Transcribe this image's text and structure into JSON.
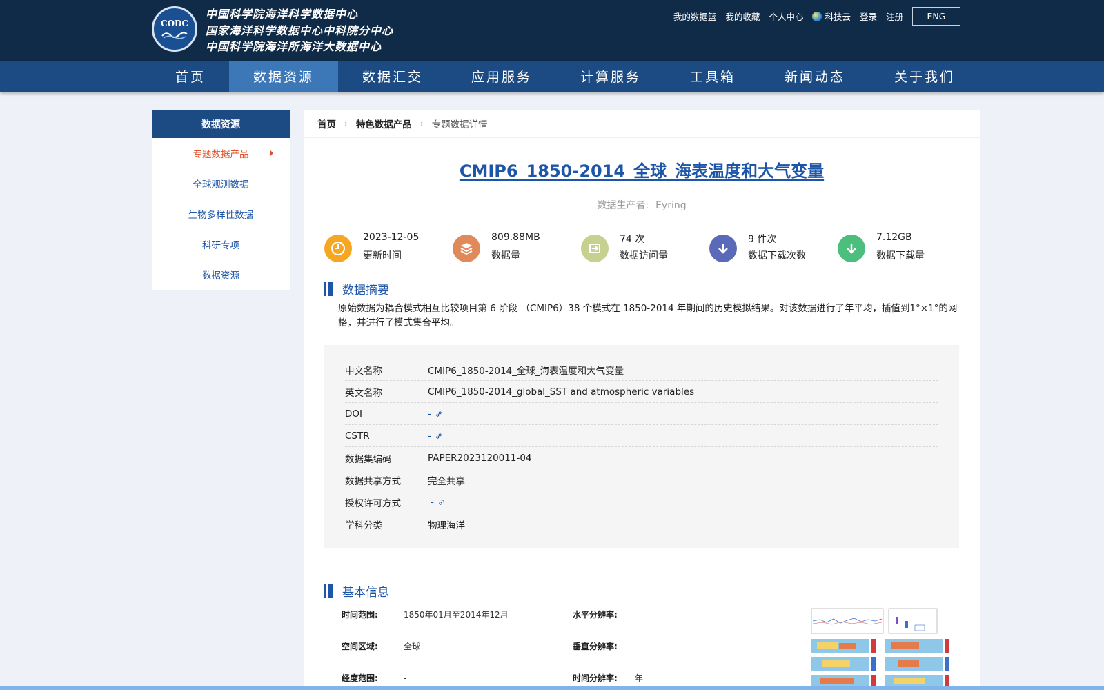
{
  "header": {
    "logo_text": "CODC",
    "org_lines": [
      "中国科学院海洋科学数据中心",
      "国家海洋科学数据中心中科院分中心",
      "中国科学院海洋所海洋大数据中心"
    ],
    "links": [
      "我的数据篮",
      "我的收藏",
      "个人中心",
      "科技云",
      "登录",
      "注册"
    ],
    "lang_button": "ENG"
  },
  "nav": {
    "items": [
      "首页",
      "数据资源",
      "数据汇交",
      "应用服务",
      "计算服务",
      "工具箱",
      "新闻动态",
      "关于我们"
    ],
    "active_index": 1
  },
  "sidebar": {
    "title": "数据资源",
    "items": [
      "专题数据产品",
      "全球观测数据",
      "生物多样性数据",
      "科研专项",
      "数据资源"
    ],
    "active_index": 0
  },
  "breadcrumb": [
    "首页",
    "特色数据产品",
    "专题数据详情"
  ],
  "dataset": {
    "title": "CMIP6_1850-2014_全球_海表温度和大气变量",
    "producer_label": "数据生产者:",
    "producer": "Eyring"
  },
  "stats": [
    {
      "value": "2023-12-05",
      "label": "更新时间",
      "icon": "clock-icon",
      "color": "#f5a623"
    },
    {
      "value": "809.88MB",
      "label": "数据量",
      "icon": "layers-icon",
      "color": "#e08a5c"
    },
    {
      "value": "74 次",
      "label": "数据访问量",
      "icon": "enter-icon",
      "color": "#c6d18f"
    },
    {
      "value": "9 件次",
      "label": "数据下载次数",
      "icon": "download-icon",
      "color": "#5b6ab8"
    },
    {
      "value": "7.12GB",
      "label": "数据下载量",
      "icon": "download-icon",
      "color": "#4cbf7f"
    }
  ],
  "abstract_section": {
    "heading": "数据摘要",
    "text": "原始数据为耦合模式相互比较项目第 6 阶段 （CMIP6）38 个模式在 1850-2014 年期间的历史模拟结果。对该数据进行了年平均，插值到1°×1°的网格，并进行了模式集合平均。"
  },
  "meta": [
    {
      "key": "中文名称",
      "value": "CMIP6_1850-2014_全球_海表温度和大气变量",
      "link": false
    },
    {
      "key": "英文名称",
      "value": "CMIP6_1850-2014_global_SST and atmospheric variables",
      "link": false
    },
    {
      "key": "DOI",
      "value": "-",
      "link": true
    },
    {
      "key": "CSTR",
      "value": "-",
      "link": true
    },
    {
      "key": "数据集编码",
      "value": "PAPER2023120011-04",
      "link": false
    },
    {
      "key": "数据共享方式",
      "value": "完全共享",
      "link": false
    },
    {
      "key": "授权许可方式",
      "value": "-",
      "link": true
    },
    {
      "key": "学科分类",
      "value": "物理海洋",
      "link": false
    }
  ],
  "basic_section": {
    "heading": "基本信息",
    "rows": [
      {
        "key": "时间范围:",
        "value": "1850年01月至2014年12月"
      },
      {
        "key": "水平分辨率:",
        "value": "-"
      },
      {
        "key": "空间区域:",
        "value": "全球"
      },
      {
        "key": "垂直分辨率:",
        "value": "-"
      },
      {
        "key": "经度范围:",
        "value": "-"
      },
      {
        "key": "时间分辨率:",
        "value": "年"
      }
    ]
  },
  "colors": {
    "header_bg": "#102b48",
    "nav_bg": "#1c4a82",
    "nav_active": "#3c77b8",
    "link_blue": "#1d56a8",
    "active_orange": "#e0502a"
  }
}
